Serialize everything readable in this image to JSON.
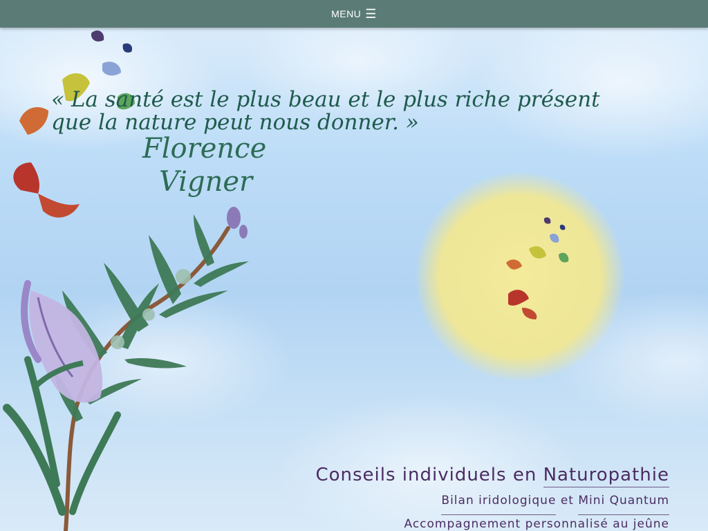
{
  "nav": {
    "menu_label": "MENU",
    "menu_icon": "☰"
  },
  "hero": {
    "quote_open": "«",
    "quote_text": "La santé est le plus beau et le plus riche présent que la nature peut nous donner.",
    "quote_close": "»",
    "logo_line1": "Florence",
    "logo_line2": "Vigner"
  },
  "tagline": {
    "title_prefix": "Conseils individuels en ",
    "title_link": "Naturopathie",
    "line2_part1": "Bilan iridologique",
    "line2_part2": "et",
    "line2_part3": "Mini Quantum",
    "line3": "Accompagnement personnalisé au jeûne"
  },
  "colors": {
    "navbar": "#5b7c76",
    "quote": "#1f5a4c",
    "tagline": "#4b2c62",
    "sun": "#f4e88e"
  }
}
